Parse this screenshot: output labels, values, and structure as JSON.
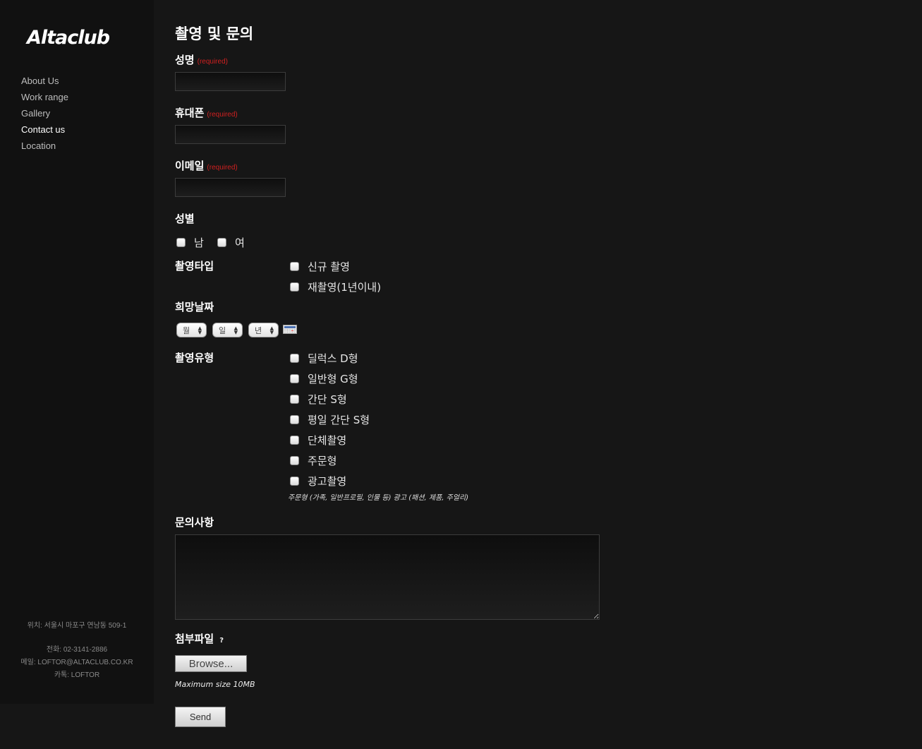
{
  "sidebar": {
    "logo": "Altaclub",
    "nav": [
      {
        "label": "About Us"
      },
      {
        "label": "Work range"
      },
      {
        "label": "Gallery"
      },
      {
        "label": "Contact us"
      },
      {
        "label": "Location"
      }
    ],
    "info": {
      "address": "위치: 서울시 마포구 연남동 509-1",
      "phone": "전화: 02-3141-2886",
      "email": "메일: LOFTOR@ALTACLUB.CO.KR",
      "kakao": "카톡: LOFTOR"
    }
  },
  "form": {
    "title": "촬영 및 문의",
    "required_text": "(required)",
    "name_label": "성명",
    "phone_label": "휴대폰",
    "email_label": "이메일",
    "gender": {
      "label": "성별",
      "options": [
        "남",
        "여"
      ]
    },
    "shoot_type": {
      "label": "촬영타입",
      "options": [
        "신규 촬영",
        "재촬영(1년이내)"
      ]
    },
    "date": {
      "label": "희망날짜",
      "month": "월",
      "day": "일",
      "year": "년"
    },
    "shoot_kind": {
      "label": "촬영유형",
      "options": [
        "딜럭스 D형",
        "일반형 G형",
        "간단 S형",
        "평일 간단 S형",
        "단체촬영",
        "주문형",
        "광고촬영"
      ],
      "note": "주문형 (가족, 일반프로필, 인물 등) 광고 (패션, 제품, 주얼리)"
    },
    "inquiry_label": "문의사항",
    "attachment": {
      "label": "첨부파일",
      "help": "?",
      "browse_label": "Browse...",
      "max_size": "Maximum size 10MB"
    },
    "send_label": "Send"
  },
  "colors": {
    "background": "#161616",
    "sidebar": "#111111",
    "required": "#d02020"
  }
}
